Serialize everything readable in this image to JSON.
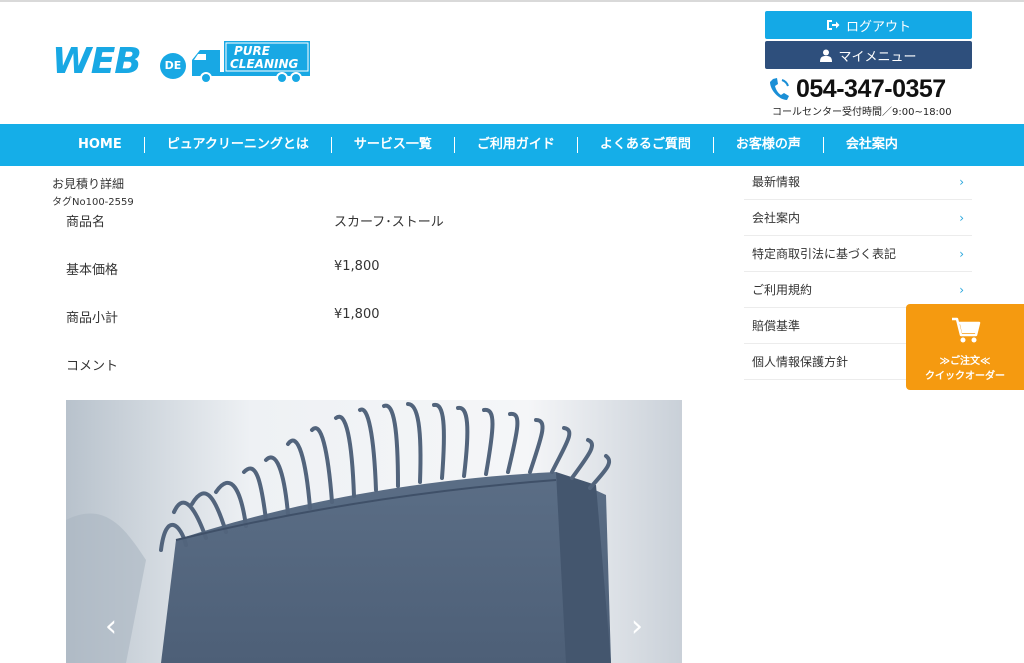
{
  "header": {
    "logo": {
      "text_web": "WEB",
      "text_de": "DE",
      "text_pure": "PURE",
      "text_cleaning": "CLEANING"
    },
    "logout_label": "ログアウト",
    "mymenu_label": "マイメニュー",
    "phone_number": "054-347-0357",
    "phone_hours": "コールセンター受付時間／9:00~18:00"
  },
  "nav": {
    "items": [
      {
        "label": "HOME"
      },
      {
        "label": "ピュアクリーニングとは"
      },
      {
        "label": "サービス一覧"
      },
      {
        "label": "ご利用ガイド"
      },
      {
        "label": "よくあるご質問"
      },
      {
        "label": "お客様の声"
      },
      {
        "label": "会社案内"
      }
    ]
  },
  "main": {
    "breadcrumb": "お見積り詳細",
    "tag_no": "タグNo100-2559",
    "rows": [
      {
        "label": "商品名",
        "value": "スカーフ･ストール"
      },
      {
        "label": "基本価格",
        "value": "¥1,800"
      },
      {
        "label": "商品小計",
        "value": "¥1,800"
      },
      {
        "label": "コメント",
        "value": ""
      }
    ],
    "photo": {
      "prev_glyph": "‹",
      "next_glyph": "›"
    }
  },
  "sidebar": {
    "items": [
      {
        "label": "最新情報",
        "chev": "›"
      },
      {
        "label": "会社案内",
        "chev": "›"
      },
      {
        "label": "特定商取引法に基づく表記",
        "chev": "›"
      },
      {
        "label": "ご利用規約",
        "chev": "›"
      },
      {
        "label": "賠償基準",
        "chev": ""
      },
      {
        "label": "個人情報保護方針",
        "chev": ""
      }
    ]
  },
  "quick_order": {
    "line1": "≫ご注文≪",
    "line2": "クイックオーダー"
  },
  "colors": {
    "brand_blue": "#15aee8",
    "dark_navy": "#2e4f7c",
    "quick_orange": "#f59a10"
  }
}
